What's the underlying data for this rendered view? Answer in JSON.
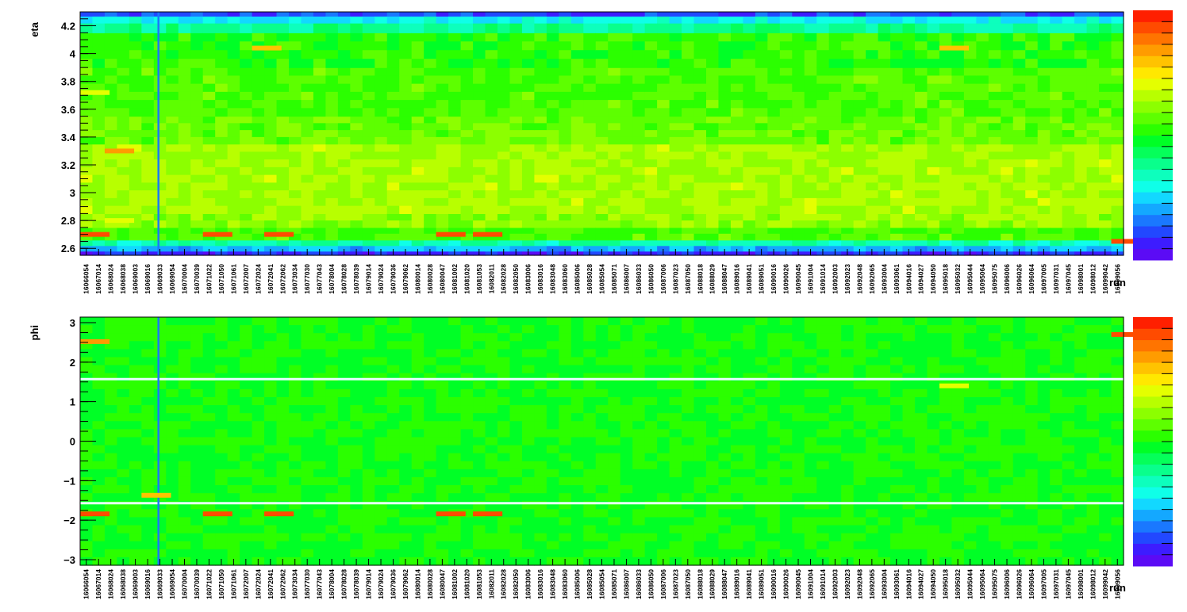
{
  "chart_data": [
    {
      "type": "heatmap",
      "ylabel": "eta",
      "xlabel": "run",
      "ylim": [
        2.55,
        4.3
      ],
      "yticks": [
        {
          "value": 2.6,
          "label": "2.6"
        },
        {
          "value": 2.8,
          "label": "2.8"
        },
        {
          "value": 3.0,
          "label": "3"
        },
        {
          "value": 3.2,
          "label": "3.2"
        },
        {
          "value": 3.4,
          "label": "3.4"
        },
        {
          "value": 3.6,
          "label": "3.6"
        },
        {
          "value": 3.8,
          "label": "3.8"
        },
        {
          "value": 4.0,
          "label": "4"
        },
        {
          "value": 4.2,
          "label": "4.2"
        }
      ],
      "colormap": "rainbow",
      "grid": false,
      "value_bands": [
        {
          "y": [
            2.55,
            2.58
          ],
          "level": 0.08
        },
        {
          "y": [
            2.58,
            2.62
          ],
          "level": 0.22
        },
        {
          "y": [
            2.62,
            2.66
          ],
          "level": 0.35
        },
        {
          "y": [
            2.66,
            2.75
          ],
          "level": 0.55
        },
        {
          "y": [
            2.75,
            2.85
          ],
          "level": 0.62
        },
        {
          "y": [
            2.85,
            3.35
          ],
          "level": 0.64
        },
        {
          "y": [
            3.35,
            3.55
          ],
          "level": 0.58
        },
        {
          "y": [
            3.55,
            3.9
          ],
          "level": 0.55
        },
        {
          "y": [
            3.9,
            4.15
          ],
          "level": 0.52
        },
        {
          "y": [
            4.15,
            4.22
          ],
          "level": 0.38
        },
        {
          "y": [
            4.22,
            4.27
          ],
          "level": 0.28
        },
        {
          "y": [
            4.27,
            4.3
          ],
          "level": 0.12
        }
      ],
      "hotspots": [
        {
          "run": "16066054",
          "y": 2.7,
          "level": 0.95
        },
        {
          "run": "16071022",
          "y": 2.7,
          "level": 0.95
        },
        {
          "run": "16072041",
          "y": 2.7,
          "level": 0.95
        },
        {
          "run": "16080047",
          "y": 2.7,
          "level": 0.95
        },
        {
          "run": "16081053",
          "y": 2.7,
          "level": 0.95
        },
        {
          "run": "16068024",
          "y": 3.3,
          "level": 0.85
        },
        {
          "run": "16072024",
          "y": 4.04,
          "level": 0.8
        },
        {
          "run": "16095018",
          "y": 4.04,
          "level": 0.8
        },
        {
          "run": "16099056",
          "y": 2.65,
          "level": 0.95
        },
        {
          "run": "16066054",
          "y": 3.72,
          "level": 0.72
        },
        {
          "run": "16068024",
          "y": 2.8,
          "level": 0.72
        }
      ]
    },
    {
      "type": "heatmap",
      "ylabel": "phi",
      "xlabel": "run",
      "ylim": [
        -3.14,
        3.14
      ],
      "yticks": [
        {
          "value": -3,
          "label": "−3"
        },
        {
          "value": -2,
          "label": "−2"
        },
        {
          "value": -1,
          "label": "−1"
        },
        {
          "value": 0,
          "label": "0"
        },
        {
          "value": 1,
          "label": "1"
        },
        {
          "value": 2,
          "label": "2"
        },
        {
          "value": 3,
          "label": "3"
        }
      ],
      "colormap": "rainbow",
      "grid": false,
      "value_bands": [
        {
          "y": [
            -3.14,
            3.14
          ],
          "level": 0.5
        }
      ],
      "white_lines": [
        -1.57,
        1.57
      ],
      "hotspots": [
        {
          "run": "16066054",
          "y": -1.84,
          "level": 0.95
        },
        {
          "run": "16071022",
          "y": -1.84,
          "level": 0.95
        },
        {
          "run": "16072041",
          "y": -1.84,
          "level": 0.95
        },
        {
          "run": "16080047",
          "y": -1.84,
          "level": 0.95
        },
        {
          "run": "16081053",
          "y": -1.84,
          "level": 0.95
        },
        {
          "run": "16066054",
          "y": 2.52,
          "level": 0.85
        },
        {
          "run": "16099056",
          "y": 2.7,
          "level": 0.95
        },
        {
          "run": "16095018",
          "y": 1.4,
          "level": 0.72
        },
        {
          "run": "16069016",
          "y": -1.37,
          "level": 0.8
        }
      ]
    }
  ],
  "runs": [
    "16066054",
    "16067014",
    "16068024",
    "16068038",
    "16069003",
    "16069016",
    "16069033",
    "16069054",
    "16070004",
    "16070039",
    "16071022",
    "16071050",
    "16071061",
    "16072007",
    "16072024",
    "16072041",
    "16072062",
    "16073034",
    "16077030",
    "16077043",
    "16078004",
    "16078028",
    "16078039",
    "16079014",
    "16079024",
    "16079036",
    "16079062",
    "16080014",
    "16080028",
    "16080047",
    "16081002",
    "16081020",
    "16081053",
    "16082011",
    "16082028",
    "16082050",
    "16083006",
    "16083016",
    "16083048",
    "16083060",
    "16085006",
    "16085028",
    "16085054",
    "16085071",
    "16086007",
    "16086033",
    "16086050",
    "16087006",
    "16087023",
    "16087050",
    "16088018",
    "16088029",
    "16088047",
    "16089016",
    "16089041",
    "16089051",
    "16090016",
    "16090026",
    "16090045",
    "16091004",
    "16091014",
    "16092003",
    "16092023",
    "16092048",
    "16092065",
    "16093004",
    "16093061",
    "16094016",
    "16094027",
    "16094050",
    "16095018",
    "16095032",
    "16095044",
    "16095064",
    "16095075",
    "16096006",
    "16096026",
    "16096064",
    "16097005",
    "16097031",
    "16097045",
    "16098001",
    "16098012",
    "16099042",
    "16099056"
  ],
  "dead_run": "16069033",
  "colors": {
    "palette": [
      "#5b0bf5",
      "#3d1cff",
      "#2248ff",
      "#1a78ff",
      "#14a8ff",
      "#12d8ff",
      "#0fffe8",
      "#0dffbd",
      "#09ff8c",
      "#05ff5a",
      "#00ff26",
      "#2bff00",
      "#5dff00",
      "#8cff00",
      "#b8ff00",
      "#e4ff00",
      "#ffe800",
      "#ffc300",
      "#ff9c00",
      "#ff7400",
      "#ff4b00",
      "#ff1f00"
    ],
    "frame": "#000000",
    "background": "#ffffff"
  }
}
